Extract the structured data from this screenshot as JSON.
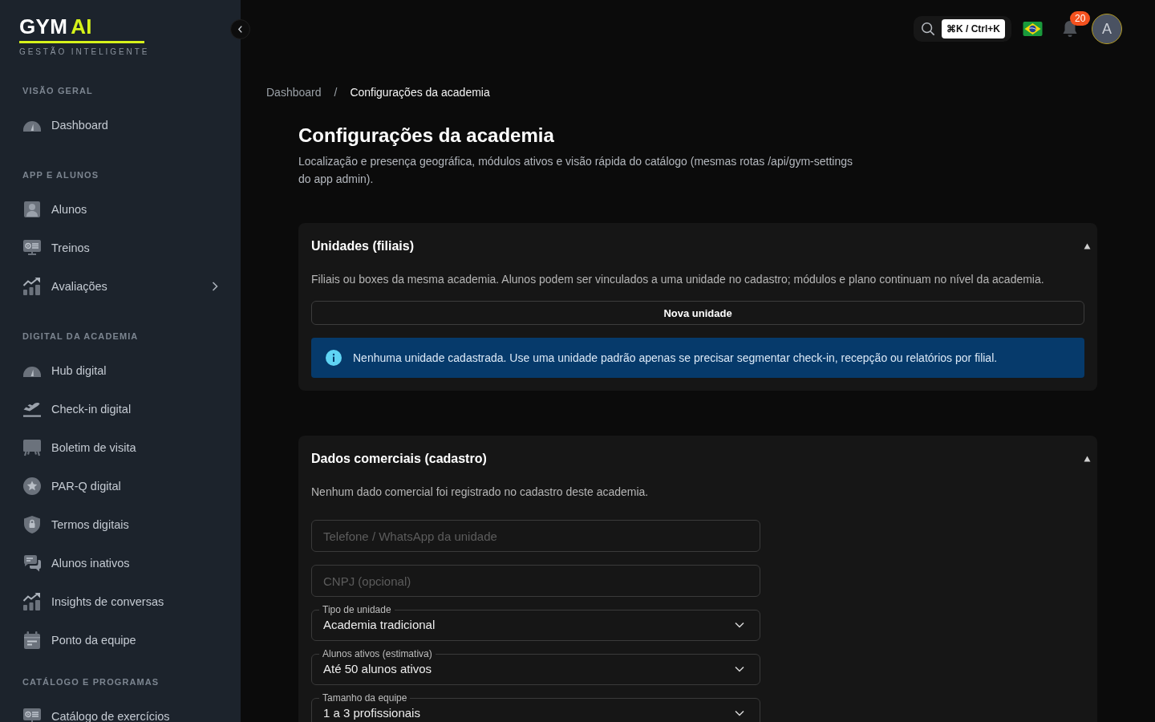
{
  "sidebar": {
    "logo": {
      "main": "GYM",
      "accent": "AI"
    },
    "tagline": "GESTÃO INTELIGENTE",
    "sections": [
      {
        "title": "VISÃO GERAL",
        "items": [
          {
            "label": "Dashboard",
            "has_submenu": false
          }
        ]
      },
      {
        "title": "APP E ALUNOS",
        "items": [
          {
            "label": "Alunos",
            "has_submenu": false
          },
          {
            "label": "Treinos",
            "has_submenu": false
          },
          {
            "label": "Avaliações",
            "has_submenu": true
          }
        ]
      },
      {
        "title": "DIGITAL DA ACADEMIA",
        "items": [
          {
            "label": "Hub digital",
            "has_submenu": false
          },
          {
            "label": "Check-in digital",
            "has_submenu": false
          },
          {
            "label": "Boletim de visita",
            "has_submenu": false
          },
          {
            "label": "PAR-Q digital",
            "has_submenu": false
          },
          {
            "label": "Termos digitais",
            "has_submenu": false
          },
          {
            "label": "Alunos inativos",
            "has_submenu": false
          },
          {
            "label": "Insights de conversas",
            "has_submenu": false
          },
          {
            "label": "Ponto da equipe",
            "has_submenu": false
          }
        ]
      },
      {
        "title": "CATÁLOGO E PROGRAMAS",
        "items": [
          {
            "label": "Catálogo de exercícios",
            "has_submenu": false
          }
        ]
      }
    ]
  },
  "topbar": {
    "search": {
      "shortcut": "⌘K / Ctrl+K"
    },
    "notifications": {
      "count": "20"
    },
    "avatar": {
      "initial": "A"
    }
  },
  "breadcrumb": {
    "separator": "/",
    "items": [
      {
        "label": "Dashboard",
        "current": false
      },
      {
        "label": "Configurações da academia",
        "current": true
      }
    ]
  },
  "page": {
    "title": "Configurações da academia",
    "description": "Localização e presença geográfica, módulos ativos e visão rápida do catálogo (mesmas rotas /api/gym-settings do app admin)."
  },
  "units_section": {
    "title": "Unidades (filiais)",
    "expanded": true,
    "description": "Filiais ou boxes da mesma academia. Alunos podem ser vinculados a uma unidade no cadastro; módulos e plano continuam no nível da academia.",
    "button": "Nova unidade",
    "alert": {
      "kind": "info",
      "text": "Nenhuma unidade cadastrada. Use uma unidade padrão apenas se precisar segmentar check-in, recepção ou relatórios por filial."
    }
  },
  "commercial_section": {
    "title": "Dados comerciais (cadastro)",
    "expanded": true,
    "description": "Nenhum dado comercial foi registrado no cadastro deste academia.",
    "fields": [
      {
        "kind": "text",
        "placeholder": "Telefone / WhatsApp da unidade"
      },
      {
        "kind": "text",
        "placeholder": "CNPJ (opcional)"
      },
      {
        "kind": "select",
        "label": "Tipo de unidade",
        "value": "Academia tradicional"
      },
      {
        "kind": "select",
        "label": "Alunos ativos (estimativa)",
        "value": "Até 50 alunos ativos"
      },
      {
        "kind": "select",
        "label": "Tamanho da equipe",
        "value": "1 a 3 profissionais"
      }
    ]
  }
}
